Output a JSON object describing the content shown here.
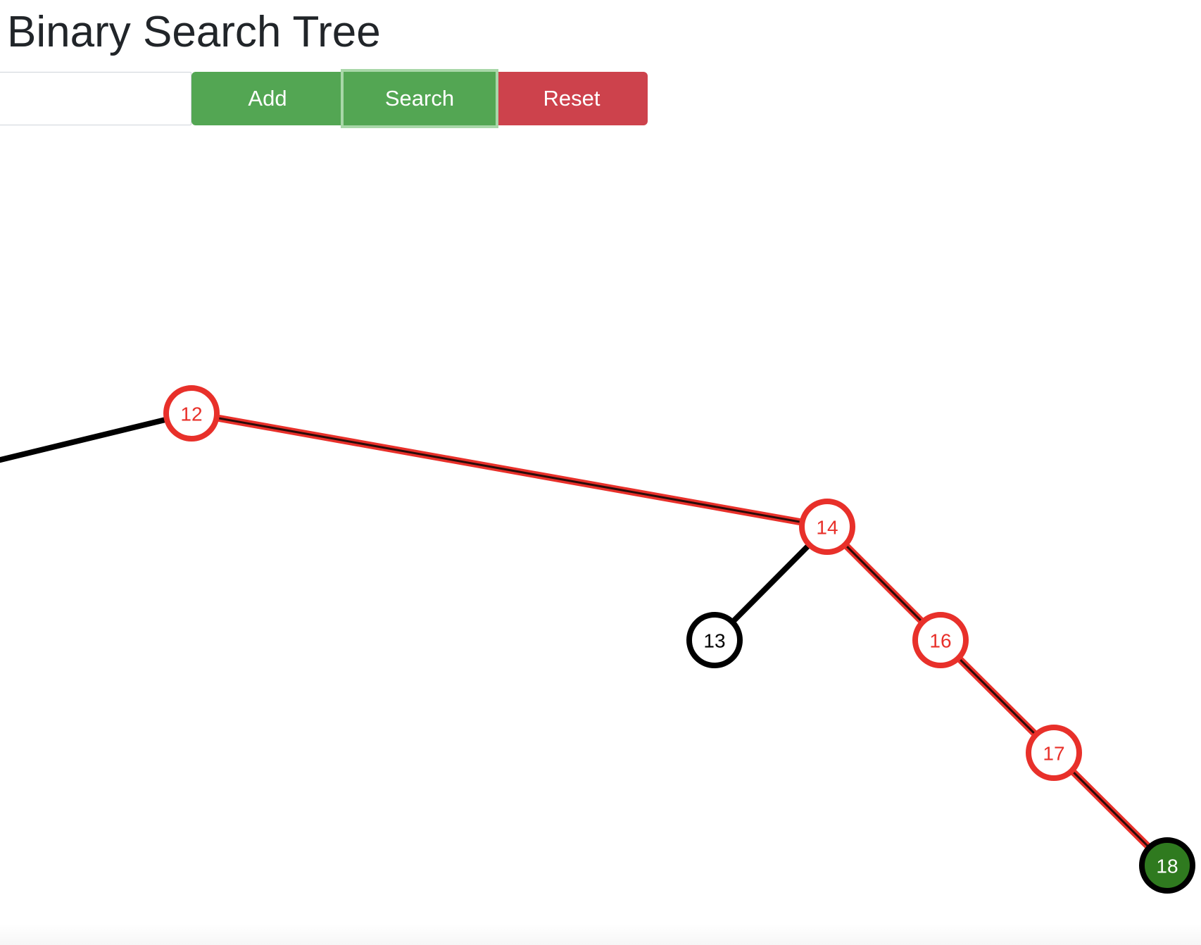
{
  "header": {
    "title": "Binary Search Tree"
  },
  "controls": {
    "input_value": "",
    "input_placeholder": "",
    "add_label": "Add",
    "search_label": "Search",
    "reset_label": "Reset"
  },
  "colors": {
    "add_button": "#53a653",
    "search_button": "#53a653",
    "reset_button": "#cd424c",
    "path_highlight": "#e8302a",
    "default_edge": "#000000",
    "found_node_fill": "#2f7a1f"
  },
  "tree": {
    "nodes": [
      {
        "value": "12",
        "state": "path"
      },
      {
        "value": "14",
        "state": "path"
      },
      {
        "value": "13",
        "state": "default"
      },
      {
        "value": "16",
        "state": "path"
      },
      {
        "value": "17",
        "state": "path"
      },
      {
        "value": "18",
        "state": "found"
      }
    ],
    "edges": [
      {
        "from": "left-offscreen",
        "to": "12",
        "state": "default"
      },
      {
        "from": "12",
        "to": "14",
        "state": "path"
      },
      {
        "from": "14",
        "to": "13",
        "state": "default"
      },
      {
        "from": "14",
        "to": "16",
        "state": "path"
      },
      {
        "from": "16",
        "to": "17",
        "state": "path"
      },
      {
        "from": "17",
        "to": "18",
        "state": "path"
      }
    ]
  }
}
